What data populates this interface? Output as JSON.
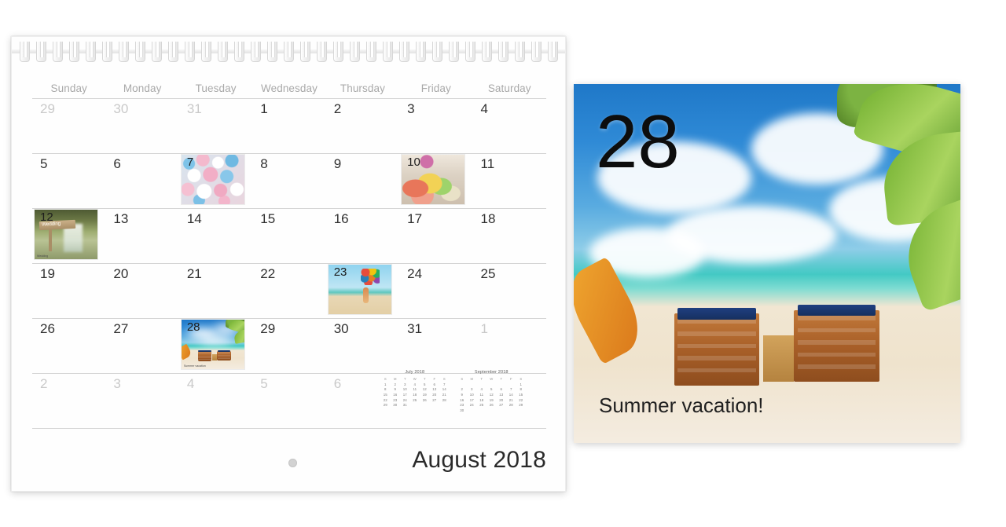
{
  "calendar": {
    "month_title": "August 2018",
    "weekdays": [
      "Sunday",
      "Monday",
      "Tuesday",
      "Wednesday",
      "Thursday",
      "Friday",
      "Saturday"
    ],
    "weeks": [
      [
        {
          "num": "29",
          "other": true
        },
        {
          "num": "30",
          "other": true
        },
        {
          "num": "31",
          "other": true
        },
        {
          "num": "1",
          "other": false
        },
        {
          "num": "2",
          "other": false
        },
        {
          "num": "3",
          "other": false
        },
        {
          "num": "4",
          "other": false
        }
      ],
      [
        {
          "num": "5",
          "other": false
        },
        {
          "num": "6",
          "other": false
        },
        {
          "num": "7",
          "other": false,
          "photo": "balls"
        },
        {
          "num": "8",
          "other": false
        },
        {
          "num": "9",
          "other": false
        },
        {
          "num": "10",
          "other": false,
          "photo": "drinks"
        },
        {
          "num": "11",
          "other": false
        }
      ],
      [
        {
          "num": "12",
          "other": false,
          "photo": "wedding",
          "caption": "Wedding"
        },
        {
          "num": "13",
          "other": false
        },
        {
          "num": "14",
          "other": false
        },
        {
          "num": "15",
          "other": false
        },
        {
          "num": "16",
          "other": false
        },
        {
          "num": "17",
          "other": false
        },
        {
          "num": "18",
          "other": false
        }
      ],
      [
        {
          "num": "19",
          "other": false
        },
        {
          "num": "20",
          "other": false
        },
        {
          "num": "21",
          "other": false
        },
        {
          "num": "22",
          "other": false
        },
        {
          "num": "23",
          "other": false,
          "photo": "balloons"
        },
        {
          "num": "24",
          "other": false
        },
        {
          "num": "25",
          "other": false
        }
      ],
      [
        {
          "num": "26",
          "other": false
        },
        {
          "num": "27",
          "other": false
        },
        {
          "num": "28",
          "other": false,
          "photo": "beach",
          "caption": "Summer vacation"
        },
        {
          "num": "29",
          "other": false
        },
        {
          "num": "30",
          "other": false
        },
        {
          "num": "31",
          "other": false
        },
        {
          "num": "1",
          "other": true
        }
      ],
      [
        {
          "num": "2",
          "other": true
        },
        {
          "num": "3",
          "other": true
        },
        {
          "num": "4",
          "other": true
        },
        {
          "num": "5",
          "other": true
        },
        {
          "num": "6",
          "other": true
        },
        {
          "num": "",
          "other": true
        },
        {
          "num": "",
          "other": true
        }
      ]
    ]
  },
  "mini_calendars": [
    {
      "title": "July 2018",
      "weekdays": [
        "S",
        "M",
        "T",
        "W",
        "T",
        "F",
        "S"
      ],
      "weeks": [
        [
          "1",
          "2",
          "3",
          "4",
          "5",
          "6",
          "7"
        ],
        [
          "8",
          "9",
          "10",
          "11",
          "12",
          "13",
          "14"
        ],
        [
          "15",
          "16",
          "17",
          "18",
          "19",
          "20",
          "21"
        ],
        [
          "22",
          "23",
          "24",
          "25",
          "26",
          "27",
          "28"
        ],
        [
          "29",
          "30",
          "31",
          "",
          "",
          "",
          ""
        ]
      ]
    },
    {
      "title": "September 2018",
      "weekdays": [
        "S",
        "M",
        "T",
        "W",
        "T",
        "F",
        "S"
      ],
      "weeks": [
        [
          "",
          "",
          "",
          "",
          "",
          "",
          "1"
        ],
        [
          "2",
          "3",
          "4",
          "5",
          "6",
          "7",
          "8"
        ],
        [
          "9",
          "10",
          "11",
          "12",
          "13",
          "14",
          "15"
        ],
        [
          "16",
          "17",
          "18",
          "19",
          "20",
          "21",
          "22"
        ],
        [
          "23",
          "24",
          "25",
          "26",
          "27",
          "28",
          "29"
        ],
        [
          "30",
          "",
          "",
          "",
          "",
          "",
          ""
        ]
      ]
    }
  ],
  "preview": {
    "day_number": "28",
    "caption": "Summer vacation!"
  },
  "colors": {
    "sky_blue": "#2f8ad6",
    "sand": "#f1e6d2",
    "chair_wood": "#a85f28",
    "cushion_blue": "#1f3f80",
    "day_text": "#303030",
    "muted_text": "#c9c9c9"
  }
}
